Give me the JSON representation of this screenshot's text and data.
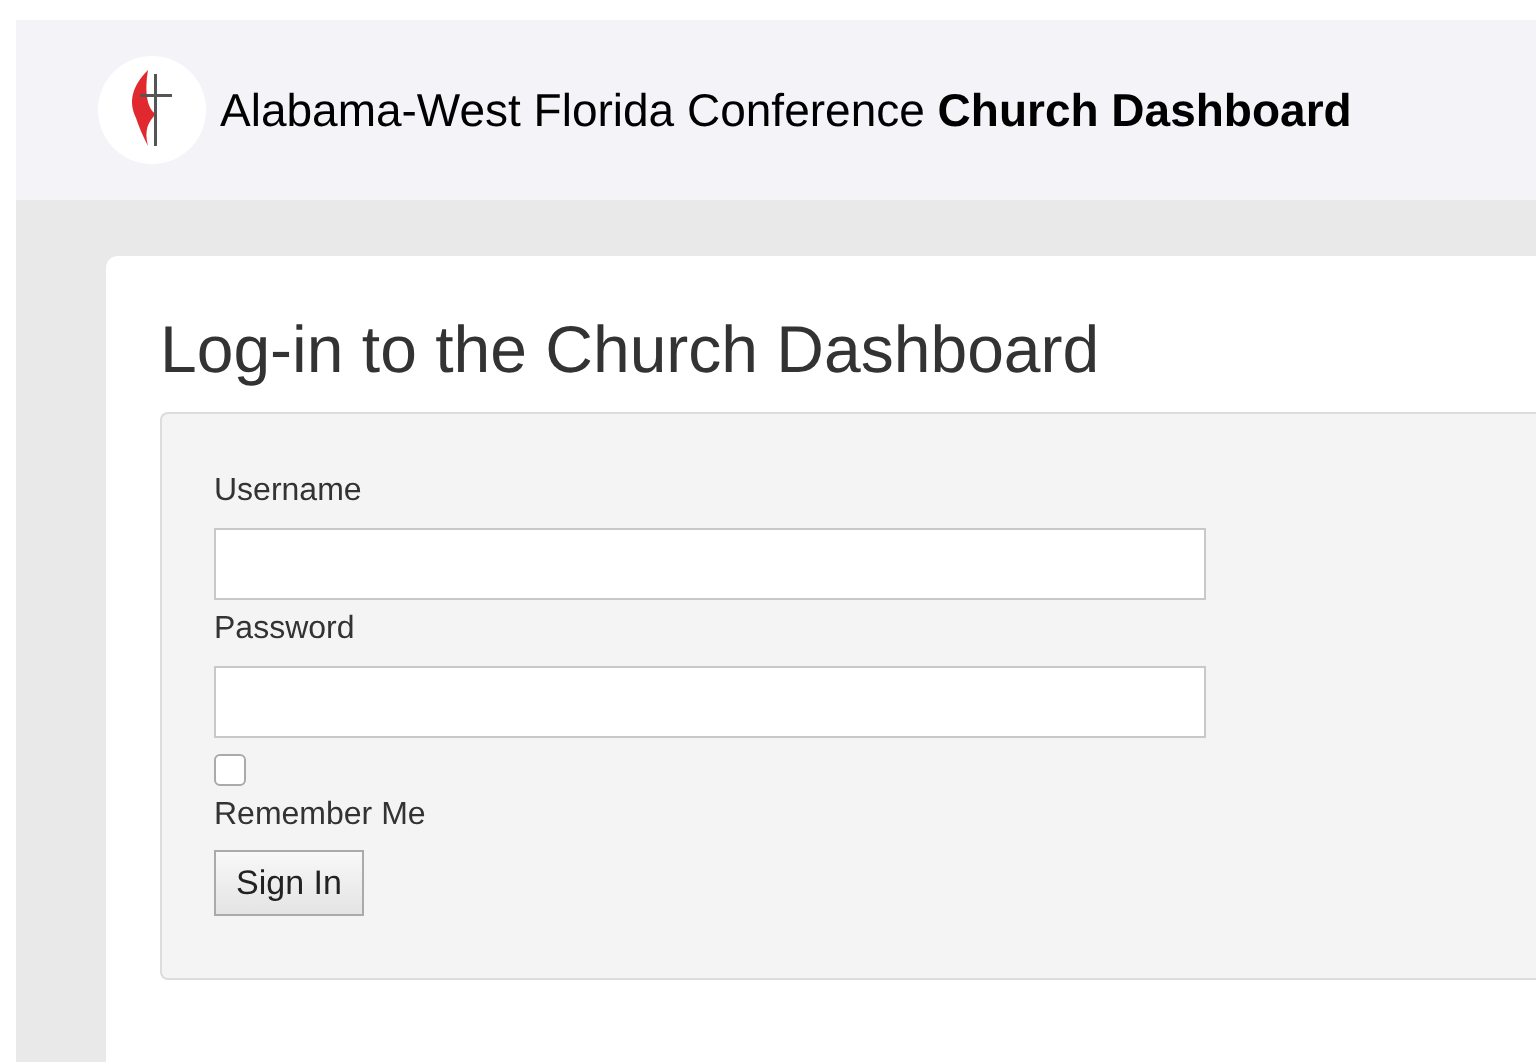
{
  "header": {
    "title": "Alabama-West Florida Conference **Church Dashboard**"
  },
  "login": {
    "heading": "Log-in to the Church Dashboard",
    "fields": [
      {
        "label": "Username"
      },
      {
        "label": "Password"
      }
    ],
    "remember": {
      "label": "Remember Me",
      "checked": false
    },
    "submit": "Sign In"
  }
}
